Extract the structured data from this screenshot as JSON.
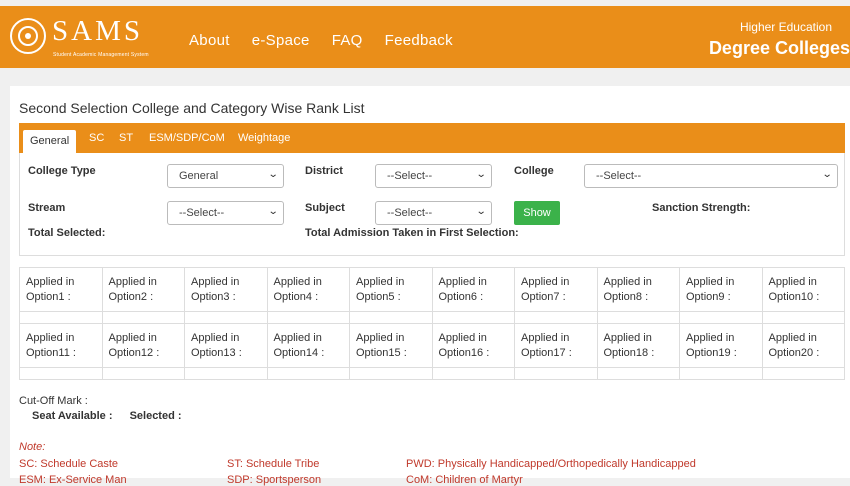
{
  "header": {
    "logo_text": "SAMS",
    "logo_subtext": "Student Academic Management System",
    "nav": [
      "About",
      "e-Space",
      "FAQ",
      "Feedback"
    ],
    "right_small": "Higher Education",
    "right_big": "Degree Colleges",
    "accent_color": "#ea8e19"
  },
  "page": {
    "title": "Second Selection College and Category Wise Rank List"
  },
  "tabs": [
    "General",
    "SC",
    "ST",
    "ESM/SDP/CoM",
    "Weightage"
  ],
  "filters": {
    "college_type_label": "College Type",
    "college_type_value": "General",
    "district_label": "District",
    "district_value": "--Select--",
    "college_label": "College",
    "college_value": "--Select--",
    "stream_label": "Stream",
    "stream_value": "--Select--",
    "subject_label": "Subject",
    "subject_value": "--Select--",
    "show_label": "Show",
    "sanction_label": "Sanction Strength:",
    "total_selected_label": "Total Selected:",
    "total_admission_label": "Total Admission Taken in First Selection:"
  },
  "options_row1": [
    "Applied in Option1 :",
    "Applied in Option2 :",
    "Applied in Option3 :",
    "Applied in Option4 :",
    "Applied in Option5 :",
    "Applied in Option6 :",
    "Applied in Option7 :",
    "Applied in Option8 :",
    "Applied in Option9 :",
    "Applied in Option10 :"
  ],
  "options_row2": [
    "Applied in Option11 :",
    "Applied in Option12 :",
    "Applied in Option13 :",
    "Applied in Option14 :",
    "Applied in Option15 :",
    "Applied in Option16 :",
    "Applied in Option17 :",
    "Applied in Option18 :",
    "Applied in Option19 :",
    "Applied in Option20 :"
  ],
  "cutoff": {
    "label": "Cut-Off Mark :",
    "seat_available": "Seat Available :",
    "selected": "Selected :"
  },
  "note": {
    "title": "Note:",
    "items": [
      "SC:  Schedule Caste",
      "ST:  Schedule Tribe",
      "PWD:  Physically Handicapped/Orthopedically Handicapped"
    ],
    "items_row2": [
      "ESM:  Ex-Service Man",
      "SDP:  Sportsperson",
      "CoM:  Children of Martyr"
    ],
    "color": "#c0392b"
  }
}
